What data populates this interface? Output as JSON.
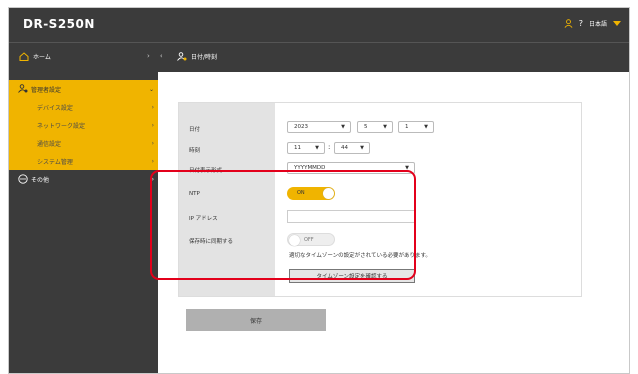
{
  "header": {
    "brand": "DR-S250N",
    "help": "?",
    "language": "日本語",
    "colors": {
      "bar": "#3b3b3b",
      "accent": "#f0b400",
      "highlight": "#e3001b"
    }
  },
  "nav": {
    "home_label": "ホーム",
    "arrow_right": "›",
    "arrow_left": "‹",
    "breadcrumb": "日付/時刻"
  },
  "sidebar": {
    "admin_label": "管理者設定",
    "admin_chevron": "⌄",
    "sub_items": [
      {
        "label": "デバイス設定",
        "chevron": "›"
      },
      {
        "label": "ネットワーク設定",
        "chevron": "›"
      },
      {
        "label": "通信設定",
        "chevron": "›"
      },
      {
        "label": "システム管理",
        "chevron": "›"
      }
    ],
    "other_label": "その他",
    "other_chevron": "›"
  },
  "form": {
    "date_label": "日付",
    "date_year": "2023",
    "date_month": "5",
    "date_day": "1",
    "time_label": "時刻",
    "time_hour": "11",
    "time_sep": ":",
    "time_minute": "44",
    "format_label": "日付表示形式",
    "format_value": "YYYYMMDD",
    "ntp_label": "NTP",
    "ntp_state": "ON",
    "ip_label": "IP アドレス",
    "ip_value": "",
    "sync_label": "保存時に同期する",
    "sync_state": "OFF",
    "tz_note": "適切なタイムゾーンの設定がされている必要があります。",
    "tz_button": "タイムゾーン設定を確認する",
    "dropdown_arrow": "▼"
  },
  "save_button": "保存"
}
